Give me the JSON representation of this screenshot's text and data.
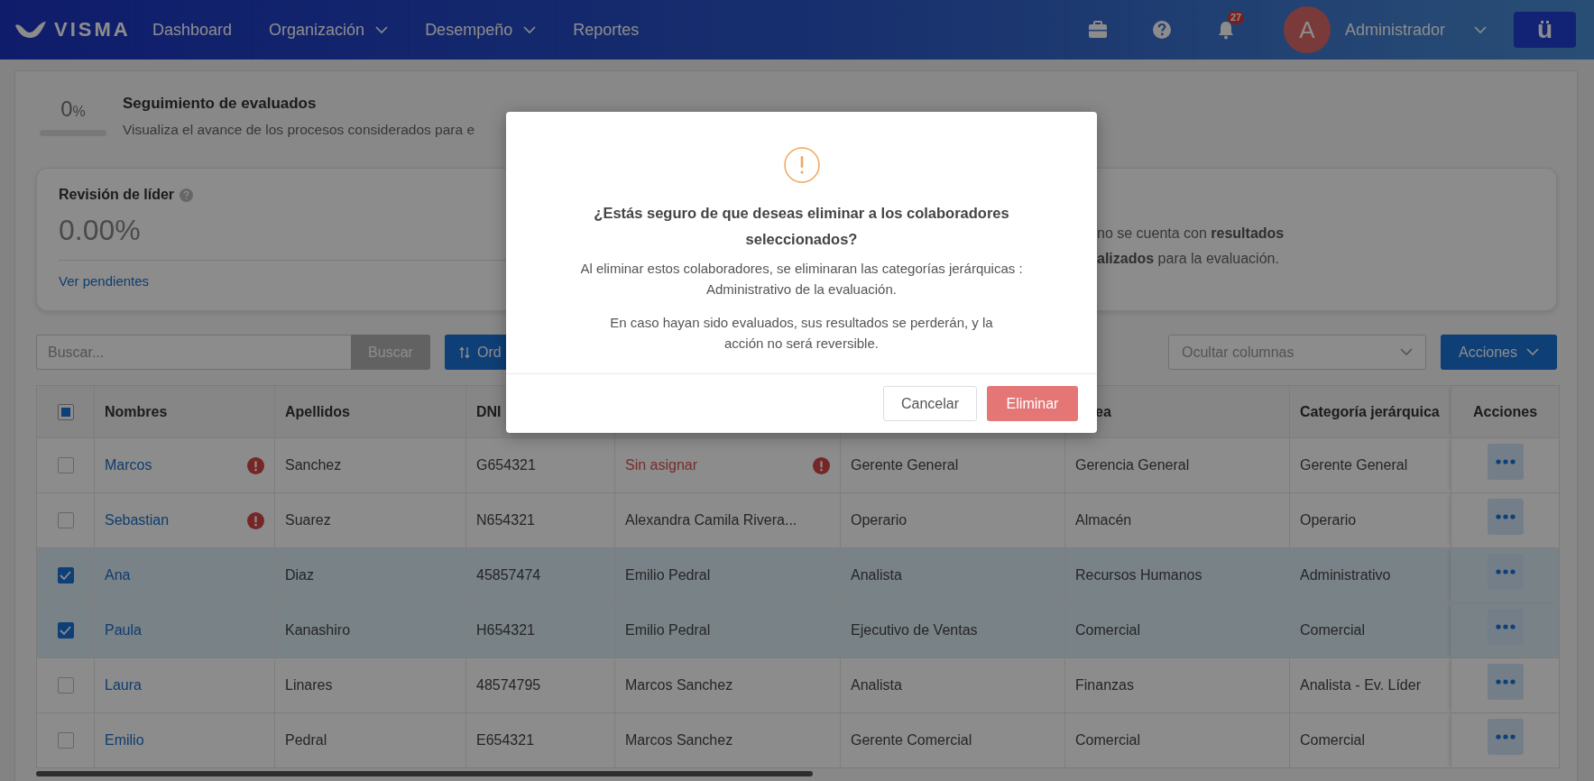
{
  "header": {
    "logo": "VISMA",
    "nav": [
      {
        "label": "Dashboard",
        "dropdown": false
      },
      {
        "label": "Organización",
        "dropdown": true
      },
      {
        "label": "Desempeño",
        "dropdown": true
      },
      {
        "label": "Reportes",
        "dropdown": false
      }
    ],
    "notification_count": "27",
    "avatar_initial": "A",
    "user_name": "Administrador",
    "app_button": "ü"
  },
  "tracking": {
    "percent": "0",
    "percent_sign": "%",
    "level": 0,
    "title": "Seguimiento de evaluados",
    "subtitle": "Visualiza el avance de los procesos considerados para e"
  },
  "summary_card": {
    "title": "Revisión de líder",
    "value": "0.00%",
    "link": "Ver pendientes",
    "note_lines": [
      "no se cuenta con **resultados**",
      "**alizados** para la evaluación."
    ]
  },
  "toolbar": {
    "search": {
      "placeholder": "Buscar..."
    },
    "search_button": "Buscar",
    "sort_button": "Ord",
    "columns_select": {
      "placeholder": "Ocultar columnas"
    },
    "actions_button": "Acciones"
  },
  "table": {
    "select_all_partial": true,
    "columns": [
      "Nombres",
      "Apellidos",
      "DNI",
      null,
      null,
      "ea",
      "Categoría jerárquica",
      "Acciones"
    ],
    "rows": [
      {
        "selected": false,
        "cells": [
          {
            "text": "Marcos",
            "kind": "link",
            "alert": true
          },
          {
            "text": "Sanchez",
            "kind": "plain",
            "alert": false
          },
          {
            "text": "G654321",
            "kind": "plain",
            "alert": false
          },
          {
            "text": "Sin asignar",
            "kind": "missing",
            "alert": true
          },
          {
            "text": "Gerente General",
            "kind": "plain",
            "alert": false
          },
          {
            "text": "Gerencia General",
            "kind": "plain",
            "alert": false
          },
          {
            "text": "Gerente General",
            "kind": "plain",
            "alert": false
          }
        ]
      },
      {
        "selected": false,
        "cells": [
          {
            "text": "Sebastian",
            "kind": "link",
            "alert": true
          },
          {
            "text": "Suarez",
            "kind": "plain",
            "alert": false
          },
          {
            "text": "N654321",
            "kind": "plain",
            "alert": false
          },
          {
            "text": "Alexandra Camila Rivera...",
            "kind": "plain",
            "alert": false
          },
          {
            "text": "Operario",
            "kind": "plain",
            "alert": false
          },
          {
            "text": "Almacén",
            "kind": "plain",
            "alert": false
          },
          {
            "text": "Operario",
            "kind": "plain",
            "alert": false
          }
        ]
      },
      {
        "selected": true,
        "cells": [
          {
            "text": "Ana",
            "kind": "link",
            "alert": false
          },
          {
            "text": "Diaz",
            "kind": "plain",
            "alert": false
          },
          {
            "text": "45857474",
            "kind": "plain",
            "alert": false
          },
          {
            "text": "Emilio Pedral",
            "kind": "plain",
            "alert": false
          },
          {
            "text": "Analista",
            "kind": "plain",
            "alert": false
          },
          {
            "text": "Recursos Humanos",
            "kind": "plain",
            "alert": false
          },
          {
            "text": "Administrativo",
            "kind": "plain",
            "alert": false
          }
        ]
      },
      {
        "selected": true,
        "cells": [
          {
            "text": "Paula",
            "kind": "link",
            "alert": false
          },
          {
            "text": "Kanashiro",
            "kind": "plain",
            "alert": false
          },
          {
            "text": "H654321",
            "kind": "plain",
            "alert": false
          },
          {
            "text": "Emilio Pedral",
            "kind": "plain",
            "alert": false
          },
          {
            "text": "Ejecutivo de Ventas",
            "kind": "plain",
            "alert": false
          },
          {
            "text": "Comercial",
            "kind": "plain",
            "alert": false
          },
          {
            "text": "Comercial",
            "kind": "plain",
            "alert": false
          }
        ]
      },
      {
        "selected": false,
        "cells": [
          {
            "text": "Laura",
            "kind": "link",
            "alert": false
          },
          {
            "text": "Linares",
            "kind": "plain",
            "alert": false
          },
          {
            "text": "48574795",
            "kind": "plain",
            "alert": false
          },
          {
            "text": "Marcos Sanchez",
            "kind": "plain",
            "alert": false
          },
          {
            "text": "Analista",
            "kind": "plain",
            "alert": false
          },
          {
            "text": "Finanzas",
            "kind": "plain",
            "alert": false
          },
          {
            "text": "Analista - Ev. Líder",
            "kind": "plain",
            "alert": false
          }
        ]
      },
      {
        "selected": false,
        "cells": [
          {
            "text": "Emilio",
            "kind": "link",
            "alert": false
          },
          {
            "text": "Pedral",
            "kind": "plain",
            "alert": false
          },
          {
            "text": "E654321",
            "kind": "plain",
            "alert": false
          },
          {
            "text": "Marcos Sanchez",
            "kind": "plain",
            "alert": false
          },
          {
            "text": "Gerente Comercial",
            "kind": "plain",
            "alert": false
          },
          {
            "text": "Comercial",
            "kind": "plain",
            "alert": false
          },
          {
            "text": "Comercial",
            "kind": "plain",
            "alert": false
          }
        ]
      }
    ]
  },
  "dialog": {
    "title": "¿Estás seguro de que deseas eliminar a los colaboradores seleccionados?",
    "paragraphs": [
      "Al eliminar estos colaboradores, se eliminaran las categorías jerárquicas : Administrativo de la evaluación.",
      "En caso hayan sido evaluados, sus resultados se perderán, y la acción no será reversible."
    ],
    "buttons": [
      {
        "label": "Cancelar",
        "kind": "secondary"
      },
      {
        "label": "Eliminar",
        "kind": "danger"
      }
    ]
  }
}
